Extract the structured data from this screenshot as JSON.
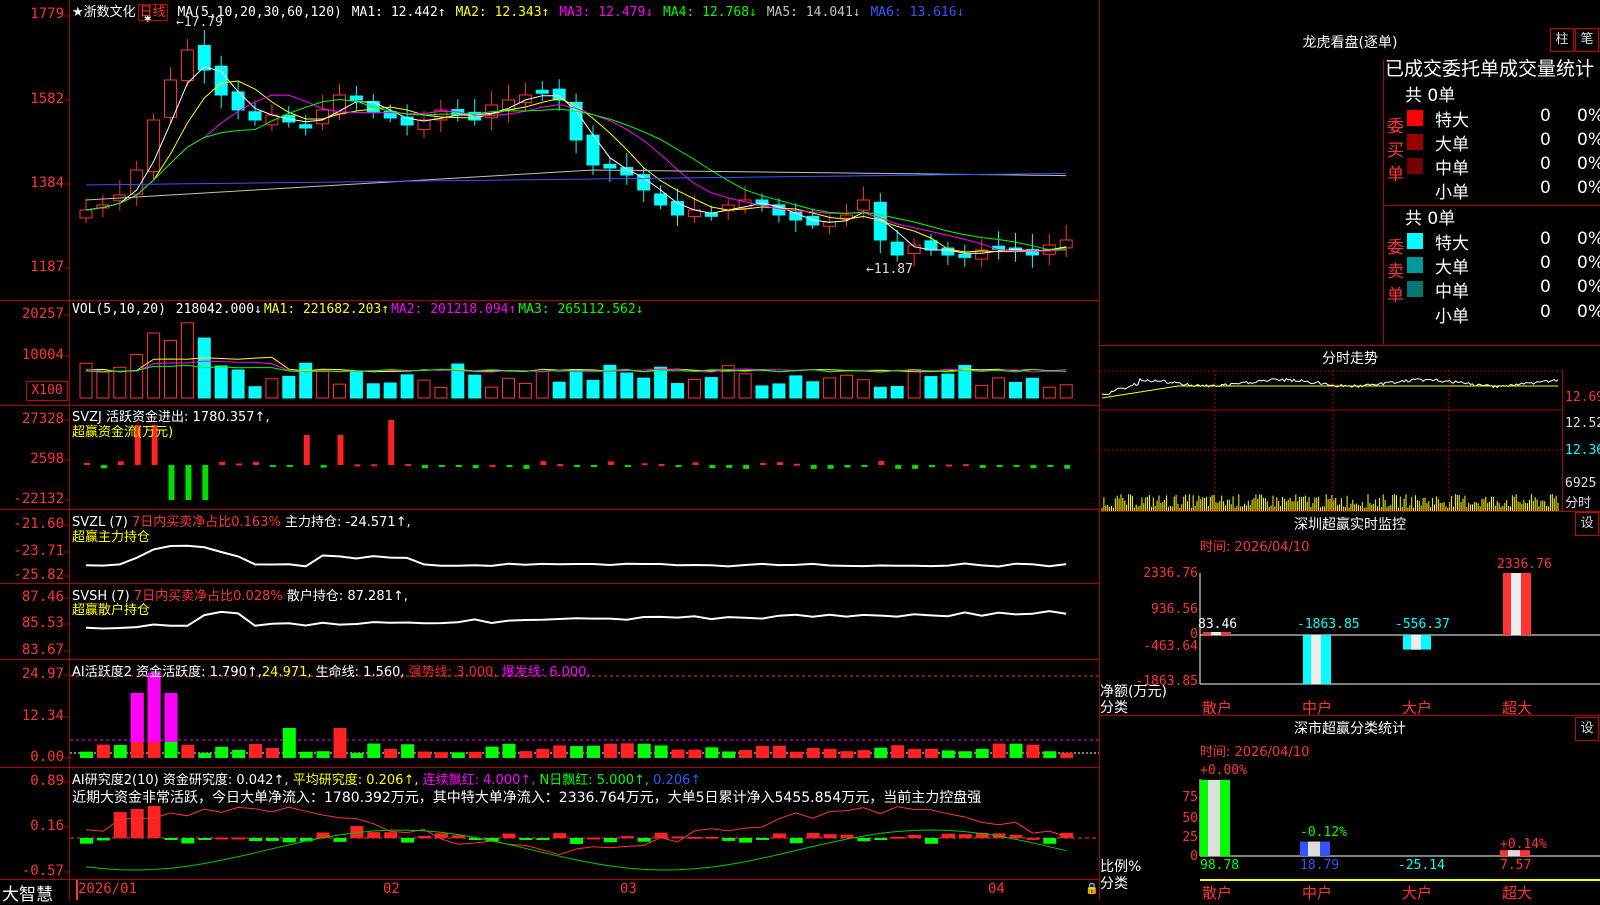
{
  "stock": {
    "name": "★浙数文化",
    "period": "日线"
  },
  "main_legend": {
    "prefix": "MA(5,10,20,30,60,120)",
    "items": [
      {
        "label": "MA1: 12.442↑",
        "color": "#ffffff"
      },
      {
        "label": "MA2: 12.343↑",
        "color": "#ffff00"
      },
      {
        "label": "MA3: 12.479↓",
        "color": "#ff00ff"
      },
      {
        "label": "MA4: 12.768↓",
        "color": "#00ff00"
      },
      {
        "label": "MA5: 14.041↓",
        "color": "#c0c0c0"
      },
      {
        "label": "MA6: 13.616↓",
        "color": "#3355ff"
      }
    ],
    "high_mark": "17.79",
    "low_mark": "11.87"
  },
  "price_axis": [
    "1779",
    "1582",
    "1384",
    "1187"
  ],
  "vol_legend": {
    "prefix": "VOL(5,10,20)",
    "items": [
      {
        "label": "218042.000↓",
        "color": "#ffffff"
      },
      {
        "label": "MA1: 221682.203↑",
        "color": "#ffff00"
      },
      {
        "label": "MA2: 201218.094↑",
        "color": "#ff00ff"
      },
      {
        "label": "MA3: 265112.562↓",
        "color": "#00ff00"
      }
    ]
  },
  "vol_axis": [
    "20257",
    "10004",
    "X100"
  ],
  "svzj": {
    "title": "SVZJ  活跃资金进出: 1780.357↑,",
    "subtitle": "超赢资金流(万元)",
    "axis": [
      "27328",
      "2598",
      "-22132"
    ]
  },
  "svzl": {
    "title": "SVZL (7)",
    "red": "7日内买卖净占比0.163%",
    "rest": "主力持仓: -24.571↑,",
    "subtitle": "超赢主力持仓",
    "axis": [
      "-21.60",
      "-23.71",
      "-25.82"
    ]
  },
  "svsh": {
    "title": "SVSH (7)",
    "red": "7日内买卖净占比0.028%",
    "rest": "散户持仓: 87.281↑,",
    "subtitle": "超赢散户持仓",
    "axis": [
      "87.46",
      "85.53",
      "83.67"
    ]
  },
  "ai2": {
    "items": [
      {
        "label": "AI活跃度2 资金活跃度: 1.790↑,",
        "color": "#ffffff"
      },
      {
        "label": "24.971,",
        "color": "#ffff00"
      },
      {
        "label": "生命线: 1.560,",
        "color": "#ffffff"
      },
      {
        "label": "强势线: 3.000,",
        "color": "#ff2222"
      },
      {
        "label": "爆发线: 6.000,",
        "color": "#ff00ff"
      }
    ],
    "axis": [
      "24.97",
      "12.34",
      "0.00"
    ]
  },
  "ai_research": {
    "items": [
      {
        "label": "AI研究度2(10) 资金研究度: 0.042↑,",
        "color": "#ffffff"
      },
      {
        "label": "平均研究度: 0.206↑,",
        "color": "#ffff00"
      },
      {
        "label": "连续飘红: 4.000↑,",
        "color": "#ff00ff"
      },
      {
        "label": "N日飘红: 5.000↑,",
        "color": "#00ff00"
      },
      {
        "label": "0.206↑",
        "color": "#3355ff"
      }
    ],
    "summary": "近期大资金非常活跃，今日大单净流入：1780.392万元，其中特大单净流入：2336.764万元，大单5日累计净入5455.854万元，当前主力控盘强",
    "axis": [
      "0.89",
      "0.16",
      "-0.57"
    ]
  },
  "date_axis": [
    "2026/01",
    "02",
    "03",
    "04"
  ],
  "brand": "大智慧",
  "dragon": {
    "title": "龙虎看盘(逐单)",
    "btn_col": "柱",
    "btn_pen": "笔",
    "section_title": "已成交委托单成交量统计",
    "buy": {
      "label": "委买单",
      "total": "共 0单",
      "rows": [
        {
          "name": "特大",
          "count": "0",
          "pct": "0%",
          "color": "#ff0000"
        },
        {
          "name": "大单",
          "count": "0",
          "pct": "0%",
          "color": "#990000"
        },
        {
          "name": "中单",
          "count": "0",
          "pct": "0%",
          "color": "#770000"
        },
        {
          "name": "小单",
          "count": "0",
          "pct": "0%",
          "color": ""
        }
      ]
    },
    "sell": {
      "label": "委卖单",
      "total": "共 0单",
      "rows": [
        {
          "name": "特大",
          "count": "0",
          "pct": "0%",
          "color": "#00ffff"
        },
        {
          "name": "大单",
          "count": "0",
          "pct": "0%",
          "color": "#009999"
        },
        {
          "name": "中单",
          "count": "0",
          "pct": "0%",
          "color": "#007777"
        },
        {
          "name": "小单",
          "count": "0",
          "pct": "0%",
          "color": ""
        }
      ]
    }
  },
  "intraday": {
    "title": "分时走势",
    "axis": [
      "12.69",
      "12.52",
      "12.36",
      "6925",
      "分时"
    ]
  },
  "monitor": {
    "title": "深圳超赢实时监控",
    "btn": "设",
    "time": "时间: 2026/04/10",
    "axis": [
      "2336.76",
      "936.56",
      "0",
      "-463.64",
      "-1863.85"
    ],
    "ylabel": "净额(万元)",
    "xlabel": "分类",
    "labels": [
      "83.46",
      "-1863.85",
      "-556.37",
      "2336.76"
    ],
    "categories": [
      "散户",
      "中户",
      "大户",
      "超大"
    ]
  },
  "classify": {
    "title": "深市超赢分类统计",
    "btn": "设",
    "time": "时间: 2026/04/10",
    "axis": [
      "75",
      "50",
      "25",
      "0"
    ],
    "ylabel": "比例%",
    "xlabel": "分类",
    "top_labels": [
      "+0.00%",
      "-0.12%",
      "",
      "+0.14%"
    ],
    "bottom_labels": [
      "98.78",
      "18.79",
      "-25.14",
      "7.57"
    ],
    "categories": [
      "散户",
      "中户",
      "大户",
      "超大"
    ]
  },
  "chart_data": [
    {
      "type": "bar",
      "title": "深圳超赢实时监控",
      "ylabel": "净额(万元)",
      "xlabel": "分类",
      "categories": [
        "散户",
        "中户",
        "大户",
        "超大"
      ],
      "values": [
        83.46,
        -1863.85,
        -556.37,
        2336.76
      ],
      "ylim": [
        -1863.85,
        2336.76
      ]
    },
    {
      "type": "bar",
      "title": "深市超赢分类统计",
      "ylabel": "比例%",
      "xlabel": "分类",
      "categories": [
        "散户",
        "中户",
        "大户",
        "超大"
      ],
      "values": [
        98.78,
        18.79,
        -25.14,
        7.57
      ],
      "ylim": [
        0,
        100
      ]
    }
  ]
}
